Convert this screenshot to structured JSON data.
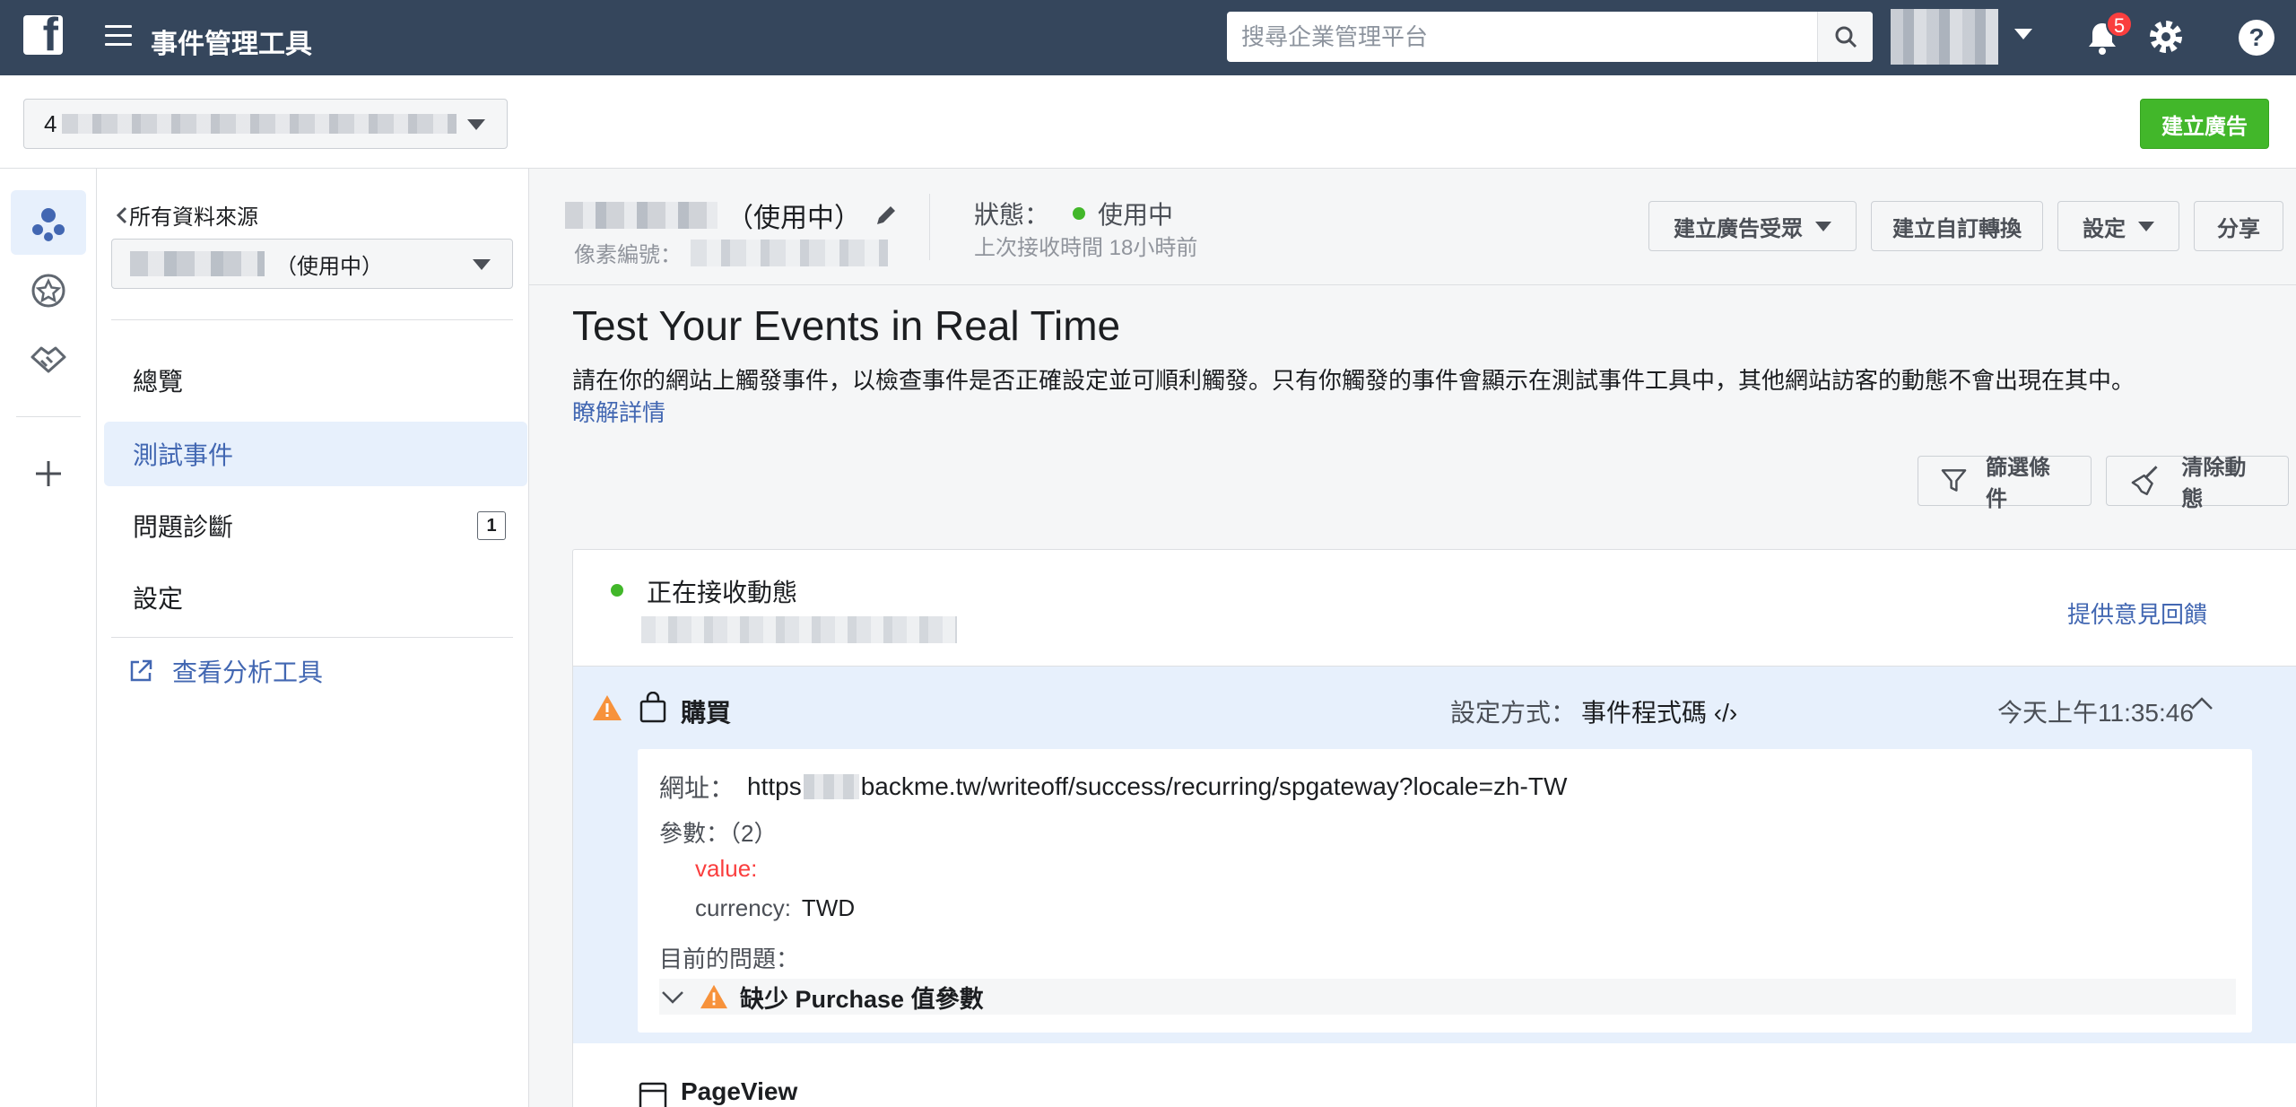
{
  "topbar": {
    "logo_letter": "f",
    "app_title": "事件管理工具",
    "search_placeholder": "搜尋企業管理平台",
    "notification_count": "5",
    "help": "?"
  },
  "subheader": {
    "account_prefix": "4",
    "create_ad_label": "建立廣告"
  },
  "nav": {
    "back_label": "所有資料來源",
    "pixel_status": "（使用中）",
    "items": [
      {
        "label": "總覽"
      },
      {
        "label": "測試事件"
      },
      {
        "label": "問題診斷",
        "count": "1"
      },
      {
        "label": "設定"
      }
    ],
    "analytics_link": "查看分析工具"
  },
  "pixel_header": {
    "status_suffix": "（使用中）",
    "pixel_id_label": "像素編號：",
    "status_label": "狀態：",
    "status_value": "使用中",
    "last_received": "上次接收時間 18小時前",
    "buttons": {
      "create_audience": "建立廣告受眾",
      "create_conversion": "建立自訂轉換",
      "settings": "設定",
      "share": "分享"
    }
  },
  "test_events": {
    "title": "Test Your Events in Real Time",
    "description": "請在你的網站上觸發事件，以檢查事件是否正確設定並可順利觸發。只有你觸發的事件會顯示在測試事件工具中，其他網站訪客的動態不會出現在其中。",
    "learn_more": "瞭解詳情",
    "filter_label": "篩選條件",
    "clear_label": "清除動態"
  },
  "activity": {
    "receiving_label": "正在接收動態",
    "feedback_link": "提供意見回饋",
    "events": [
      {
        "name": "購買",
        "method_label": "設定方式：",
        "method": "事件程式碼 ‹/›",
        "time": "今天上午11:35:46",
        "url_label": "網址：",
        "url_prefix": "https",
        "url_suffix": "backme.tw/writeoff/success/recurring/spgateway?locale=zh-TW",
        "params_label": "參數：（2）",
        "param_value": "value:",
        "param_currency_label": "currency:",
        "param_currency_value": "TWD",
        "issues_label": "目前的問題：",
        "issue_text": "缺少 Purchase 值參數"
      },
      {
        "name": "PageView"
      }
    ]
  }
}
